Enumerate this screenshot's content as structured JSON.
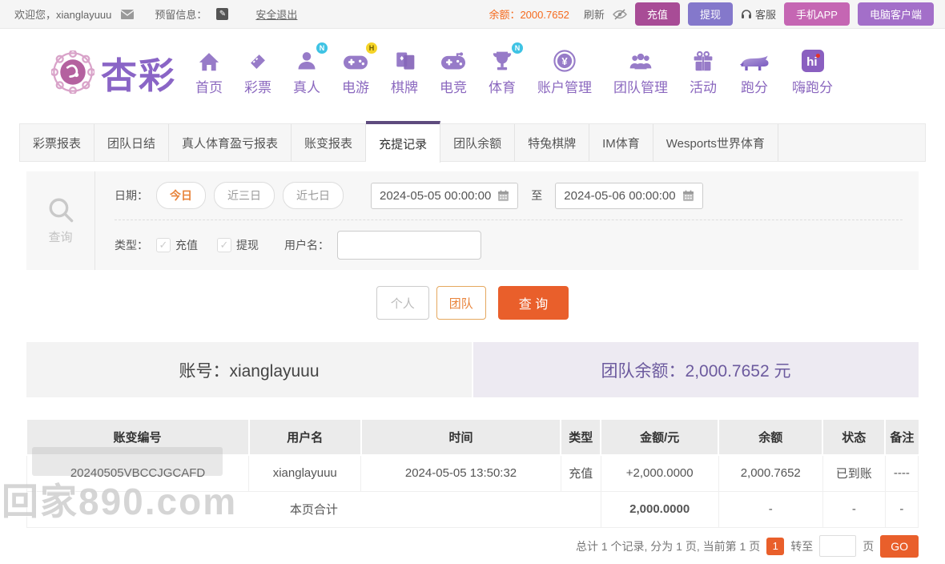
{
  "topbar": {
    "welcome": "欢迎您，xianglayuuu",
    "reserved_info": "预留信息：",
    "logout": "安全退出",
    "balance": "余额：2000.7652",
    "refresh": "刷新",
    "deposit": "充值",
    "withdraw": "提现",
    "service": "客服",
    "mobile_app": "手机APP",
    "pc_client": "电脑客户端"
  },
  "nav": {
    "logo_text": "杏彩",
    "items": [
      {
        "label": "首页"
      },
      {
        "label": "彩票"
      },
      {
        "label": "真人",
        "badge": "N"
      },
      {
        "label": "电游",
        "badge": "H"
      },
      {
        "label": "棋牌"
      },
      {
        "label": "电竞"
      },
      {
        "label": "体育",
        "badge": "N"
      },
      {
        "label": "账户管理"
      },
      {
        "label": "团队管理"
      },
      {
        "label": "活动"
      },
      {
        "label": "跑分"
      },
      {
        "label": "嗨跑分"
      }
    ]
  },
  "tabs": [
    {
      "label": "彩票报表"
    },
    {
      "label": "团队日结"
    },
    {
      "label": "真人体育盈亏报表"
    },
    {
      "label": "账变报表"
    },
    {
      "label": "充提记录",
      "active": true
    },
    {
      "label": "团队余额"
    },
    {
      "label": "特兔棋牌"
    },
    {
      "label": "IM体育"
    },
    {
      "label": "Wesports世界体育"
    }
  ],
  "filter": {
    "section_label": "查询",
    "date_label": "日期：",
    "preset_today": "今日",
    "preset_3days": "近三日",
    "preset_7days": "近七日",
    "date_from": "2024-05-05 00:00:00",
    "to_label": "至",
    "date_to": "2024-05-06 00:00:00",
    "type_label": "类型：",
    "type_deposit": "充值",
    "type_withdraw": "提现",
    "check_glyph": "✓",
    "username_label": "用户名：",
    "personal_btn": "个人",
    "team_btn": "团队",
    "search_btn": "查 询"
  },
  "account": {
    "account_text": "账号：xianglayuuu",
    "team_balance_text": "团队余额：2,000.7652 元"
  },
  "table": {
    "headers": [
      "账变编号",
      "用户名",
      "时间",
      "类型",
      "金额/元",
      "余额",
      "状态",
      "备注"
    ],
    "rows": [
      {
        "id": "20240505VBCCJGCAFD",
        "username": "xianglayuuu",
        "time": "2024-05-05 13:50:32",
        "type": "充值",
        "amount": "+2,000.0000",
        "balance": "2,000.7652",
        "status": "已到账",
        "remark": "----"
      }
    ],
    "summary": {
      "label": "本页合计",
      "amount": "2,000.0000",
      "balance": "-",
      "status": "-",
      "remark": "-"
    }
  },
  "pagination": {
    "summary": "总计 1 个记录, 分为 1 页, 当前第 1 页",
    "current_page": "1",
    "goto_label": "转至",
    "page_label": "页",
    "go_btn": "GO"
  },
  "watermark": "回家890.com",
  "colors": {
    "accent_orange": "#e95f2b",
    "balance_orange": "#f56a1d",
    "nav_purple": "#8b68bf",
    "tab_active_border": "#5e4b7e",
    "deposit_btn": "#a84c96",
    "withdraw_btn": "#8478cb",
    "mobile_btn": "#c566b3",
    "pc_btn": "#a36fc9",
    "success_green": "#74ad3e",
    "team_balance_purple": "#6c5a9e"
  }
}
